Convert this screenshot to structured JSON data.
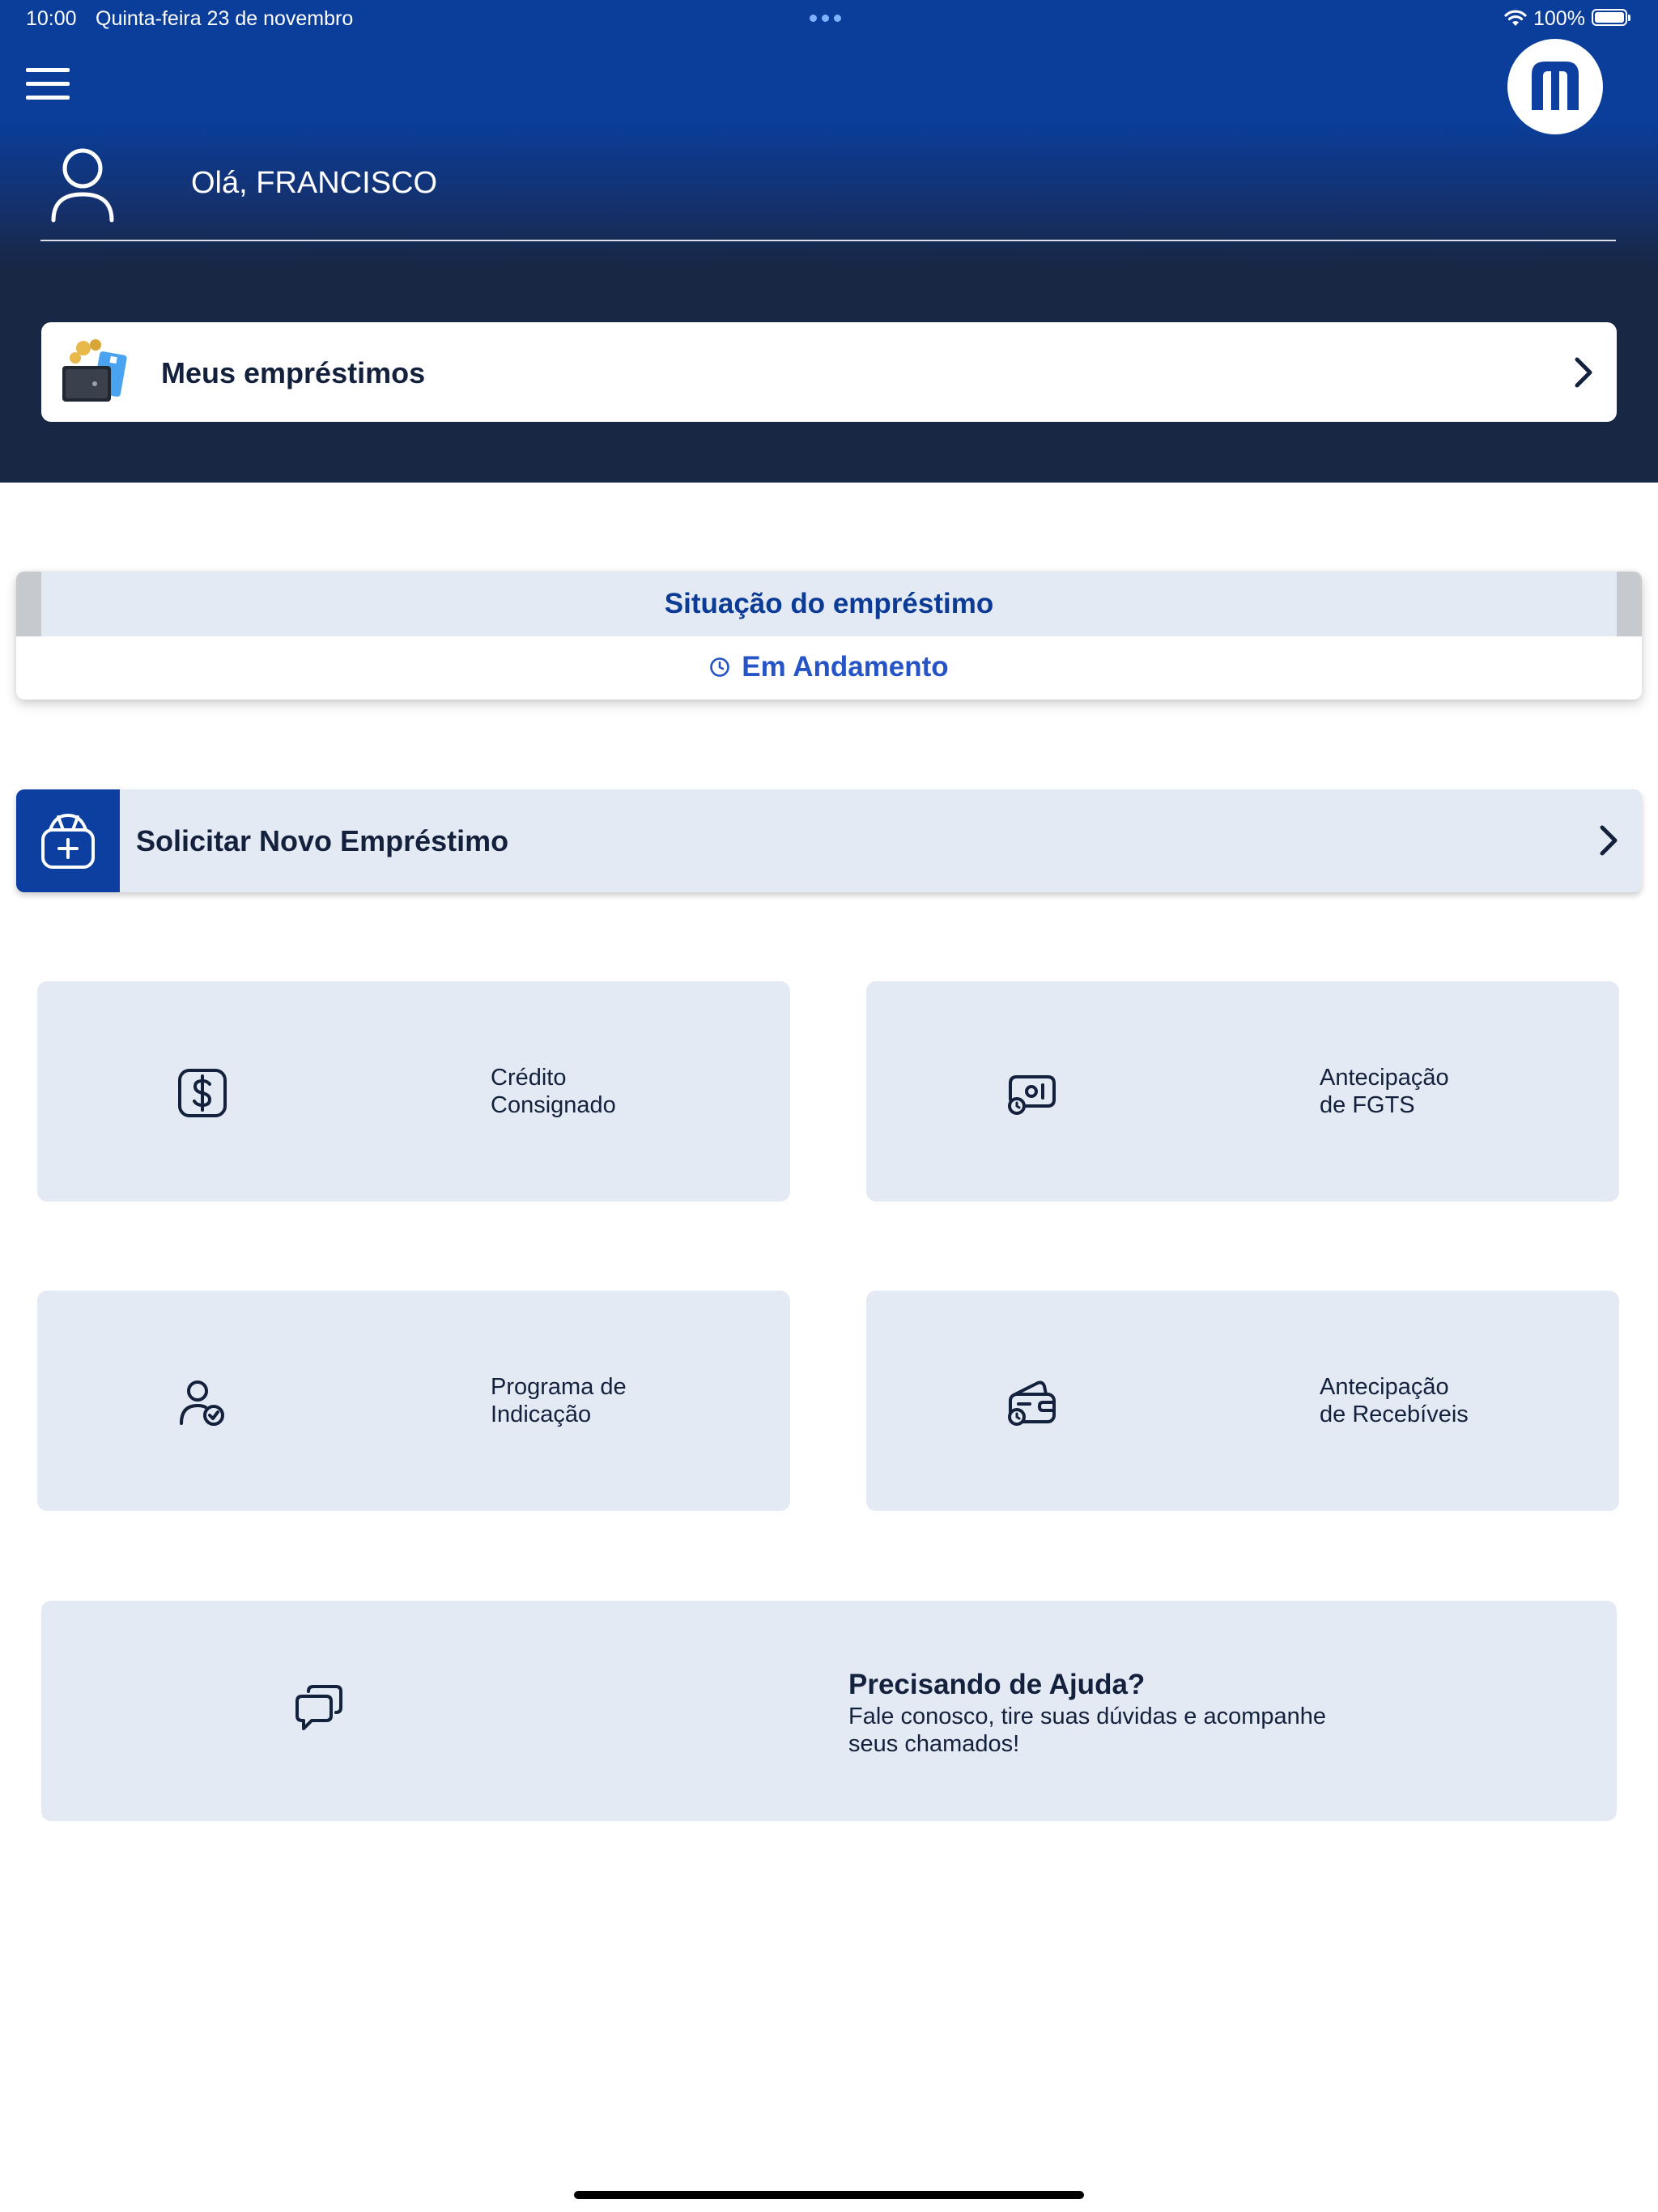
{
  "status_bar": {
    "time": "10:00",
    "date": "Quinta-feira 23 de novembro",
    "battery": "100%"
  },
  "header": {
    "greeting": "Olá, FRANCISCO"
  },
  "loans_card": {
    "label": "Meus empréstimos"
  },
  "loan_status": {
    "title": "Situação do empréstimo",
    "value": "Em Andamento"
  },
  "new_loan": {
    "label": "Solicitar Novo Empréstimo"
  },
  "services": [
    {
      "label": "Crédito\nConsignado",
      "icon": "dollar-icon"
    },
    {
      "label": "Antecipação\nde FGTS",
      "icon": "fgts-icon"
    },
    {
      "label": "Programa de\nIndicação",
      "icon": "user-check-icon"
    },
    {
      "label": "Antecipação\nde Recebíveis",
      "icon": "wallet-clock-icon"
    }
  ],
  "help": {
    "title": "Precisando de Ajuda?",
    "text": "Fale conosco, tire suas dúvidas e acompanhe seus chamados!"
  },
  "colors": {
    "header_top": "#0a3e9a",
    "header_bottom": "#172744",
    "accent": "#0c3b95",
    "status_blue": "#2554c7",
    "tile_bg": "#e4eaf4"
  }
}
